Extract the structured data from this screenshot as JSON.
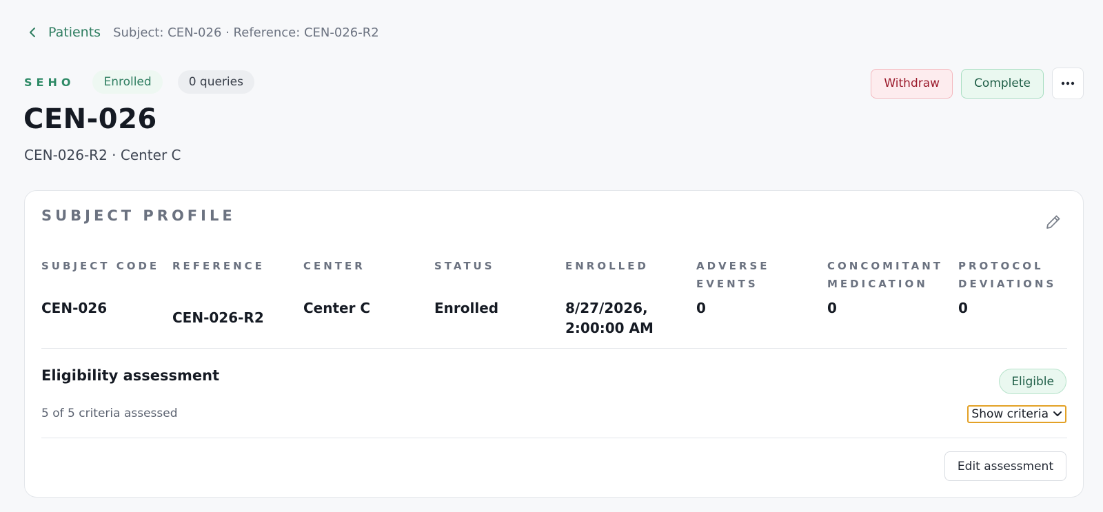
{
  "breadcrumb": {
    "link": "Patients",
    "meta": "Subject: CEN-026 · Reference: CEN-026-R2"
  },
  "header": {
    "study_code": "SEHO",
    "status_badge": "Enrolled",
    "queries_badge": "0 queries",
    "title": "CEN-026",
    "subtitle": "CEN-026-R2 · Center C"
  },
  "actions": {
    "withdraw": "Withdraw",
    "complete": "Complete"
  },
  "profile": {
    "title": "SUBJECT PROFILE",
    "fields": [
      {
        "label": "SUBJECT CODE",
        "value": "CEN-026"
      },
      {
        "label": "REFERENCE",
        "value": "CEN-026-R2"
      },
      {
        "label": "CENTER",
        "value": "Center C"
      },
      {
        "label": "STATUS",
        "value": "Enrolled"
      },
      {
        "label": "ENROLLED",
        "value": "8/27/2026, 2:00:00 AM"
      },
      {
        "label": "ADVERSE EVENTS",
        "value": "0"
      },
      {
        "label": "CONCOMITANT MEDICATION",
        "value": "0"
      },
      {
        "label": "PROTOCOL DEVIATIONS",
        "value": "0"
      }
    ]
  },
  "eligibility": {
    "title": "Eligibility assessment",
    "badge": "Eligible",
    "count": "5 of 5 criteria assessed",
    "show_criteria": "Show criteria",
    "edit_button": "Edit assessment"
  },
  "colors": {
    "accent_green": "#2e7d60",
    "danger": "#9b1b2c",
    "focus_ring": "#e3a126"
  }
}
